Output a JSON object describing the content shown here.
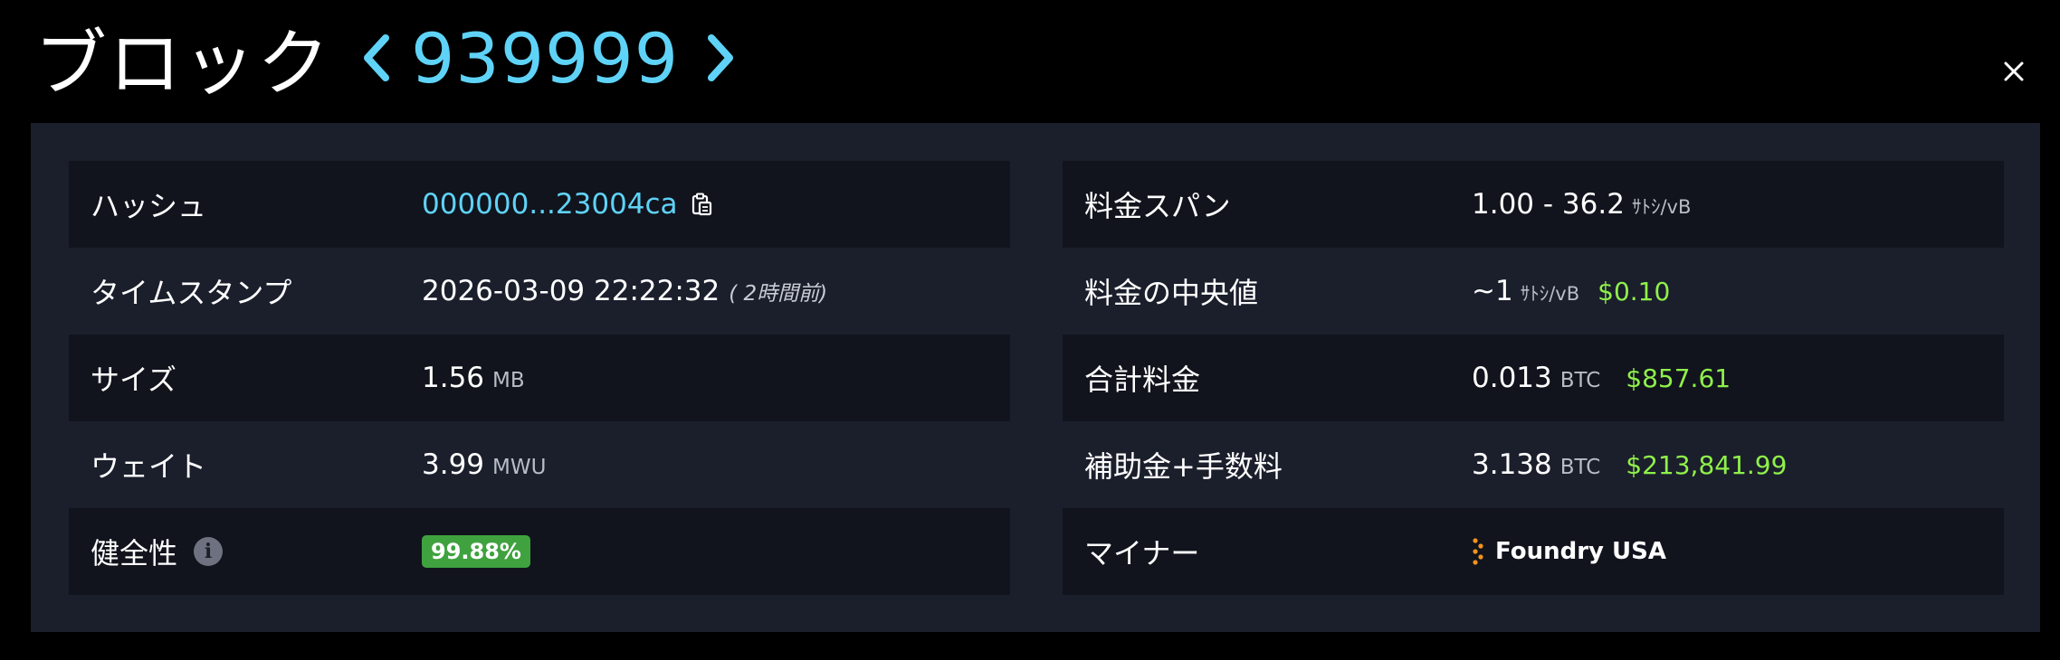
{
  "header": {
    "title": "ブロック",
    "block_number": "939999"
  },
  "left": {
    "hash": {
      "label": "ハッシュ",
      "value": "000000...23004ca"
    },
    "timestamp": {
      "label": "タイムスタンプ",
      "value": "2026-03-09 22:22:32",
      "relative": "( 2時間前)"
    },
    "size": {
      "label": "サイズ",
      "value": "1.56",
      "unit": "MB"
    },
    "weight": {
      "label": "ウェイト",
      "value": "3.99",
      "unit": "MWU"
    },
    "health": {
      "label": "健全性",
      "value": "99.88%"
    }
  },
  "right": {
    "fee_span": {
      "label": "料金スパン",
      "value": "1.00 - 36.2",
      "unit": "ｻﾄｼ/vB"
    },
    "median_fee": {
      "label": "料金の中央値",
      "value": "~1",
      "unit": "ｻﾄｼ/vB",
      "fiat": "$0.10"
    },
    "total_fees": {
      "label": "合計料金",
      "value": "0.013",
      "unit": "BTC",
      "fiat": "$857.61"
    },
    "subsidy_fees": {
      "label": "補助金+手数料",
      "value": "3.138",
      "unit": "BTC",
      "fiat": "$213,841.99"
    },
    "miner": {
      "label": "マイナー",
      "value": "Foundry USA"
    }
  },
  "icons": {
    "prev": "chevron-left-icon",
    "next": "chevron-right-icon",
    "close": "close-icon",
    "copy": "clipboard-icon",
    "info": "info-icon",
    "miner_logo": "foundry-logo-icon"
  },
  "colors": {
    "accent": "#5fd3f7",
    "fiat": "#8ff04a",
    "health_badge": "#3fa23f",
    "panel": "#1b1f2c",
    "row_dark": "#11141d"
  }
}
